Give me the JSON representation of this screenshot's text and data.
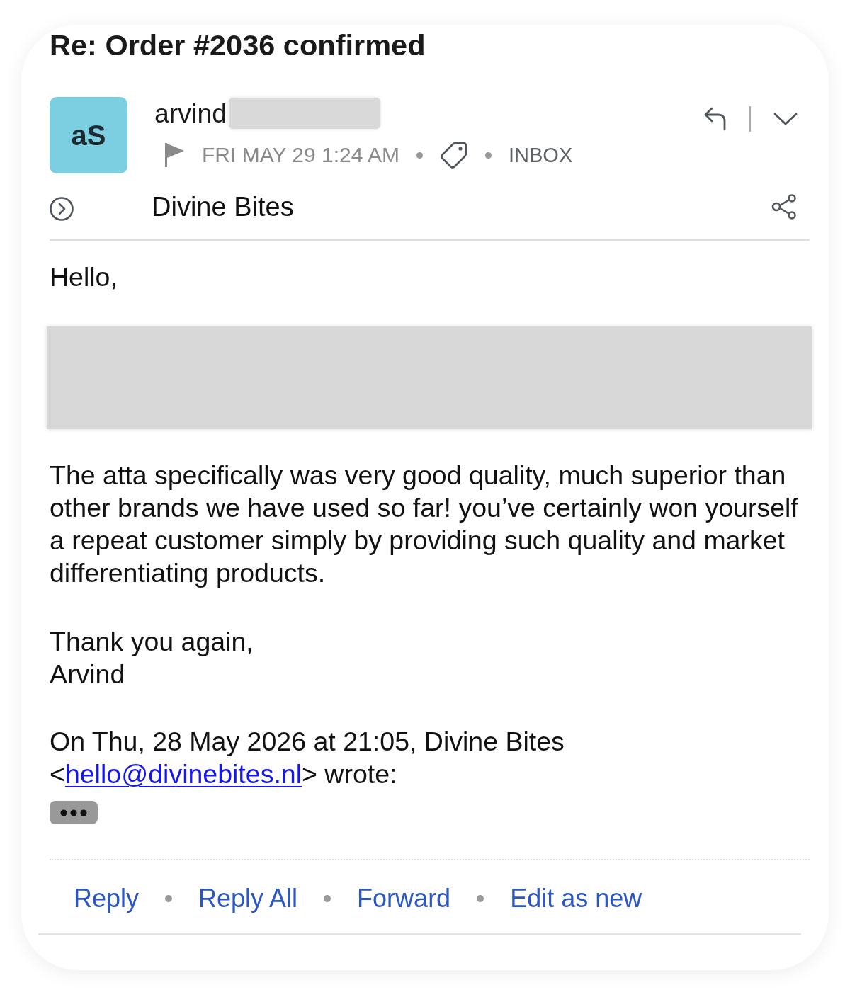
{
  "message": {
    "subject": "Re: Order #2036 confirmed"
  },
  "sender": {
    "initials": "aS",
    "name": "arvind",
    "surname_redacted": true
  },
  "meta": {
    "date": "FRI MAY 29 1:24 AM",
    "folder": "INBOX"
  },
  "recipient": {
    "name": "Divine Bites"
  },
  "body": [
    {
      "kind": "paragraph",
      "text": "Hello,"
    },
    {
      "kind": "redacted"
    },
    {
      "kind": "paragraph",
      "text": "The atta specifically was very good quality, much superior than other brands we have used so far! you’ve certainly won yourself a repeat customer simply by providing such quality and market differentiating products."
    },
    {
      "kind": "signature",
      "lines": [
        "Thank you again,",
        "Arvind"
      ]
    },
    {
      "kind": "quote_header",
      "header": "On Thu, 28 May 2026 at 21:05, Divine Bites",
      "open": "<",
      "email": "hello@divinebites.nl",
      "close": "> wrote:"
    },
    {
      "kind": "quote_toggle"
    }
  ],
  "actions": [
    {
      "label": "Reply"
    },
    {
      "label": "Reply All"
    },
    {
      "label": "Forward"
    },
    {
      "label": "Edit as new"
    }
  ]
}
